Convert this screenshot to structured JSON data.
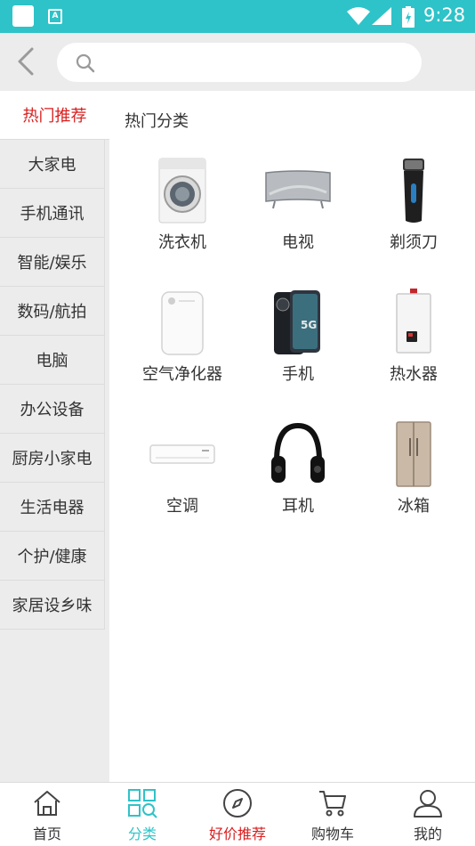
{
  "status_bar": {
    "time": "9:28",
    "icons": [
      "app-square-icon",
      "accessibility-a-icon",
      "wifi-icon",
      "cell-signal-icon",
      "battery-icon"
    ]
  },
  "search": {
    "value": "",
    "placeholder": ""
  },
  "sidebar": {
    "items": [
      {
        "label": "热门推荐",
        "active": true
      },
      {
        "label": "大家电"
      },
      {
        "label": "手机通讯"
      },
      {
        "label": "智能/娱乐"
      },
      {
        "label": "数码/航拍"
      },
      {
        "label": "电脑"
      },
      {
        "label": "办公设备"
      },
      {
        "label": "厨房小家电"
      },
      {
        "label": "生活电器"
      },
      {
        "label": "个护/健康"
      },
      {
        "label": "家居设乡味"
      }
    ]
  },
  "main": {
    "section_title": "热门分类",
    "categories": [
      {
        "label": "洗衣机",
        "icon": "washing-machine-icon"
      },
      {
        "label": "电视",
        "icon": "tv-icon"
      },
      {
        "label": "剃须刀",
        "icon": "shaver-icon"
      },
      {
        "label": "空气净化器",
        "icon": "air-purifier-icon"
      },
      {
        "label": "手机",
        "icon": "phone-icon"
      },
      {
        "label": "热水器",
        "icon": "water-heater-icon"
      },
      {
        "label": "空调",
        "icon": "air-conditioner-icon"
      },
      {
        "label": "耳机",
        "icon": "headphones-icon"
      },
      {
        "label": "冰箱",
        "icon": "fridge-icon"
      }
    ]
  },
  "bottom_nav": {
    "tabs": [
      {
        "label": "首页",
        "icon": "home-icon"
      },
      {
        "label": "分类",
        "icon": "category-grid-icon",
        "active": true
      },
      {
        "label": "好价推荐",
        "icon": "compass-icon"
      },
      {
        "label": "购物车",
        "icon": "cart-icon"
      },
      {
        "label": "我的",
        "icon": "user-icon"
      }
    ]
  },
  "colors": {
    "accent": "#2ec3c8",
    "highlight_red": "#d81e1e",
    "sidebar_bg": "#ececec"
  }
}
